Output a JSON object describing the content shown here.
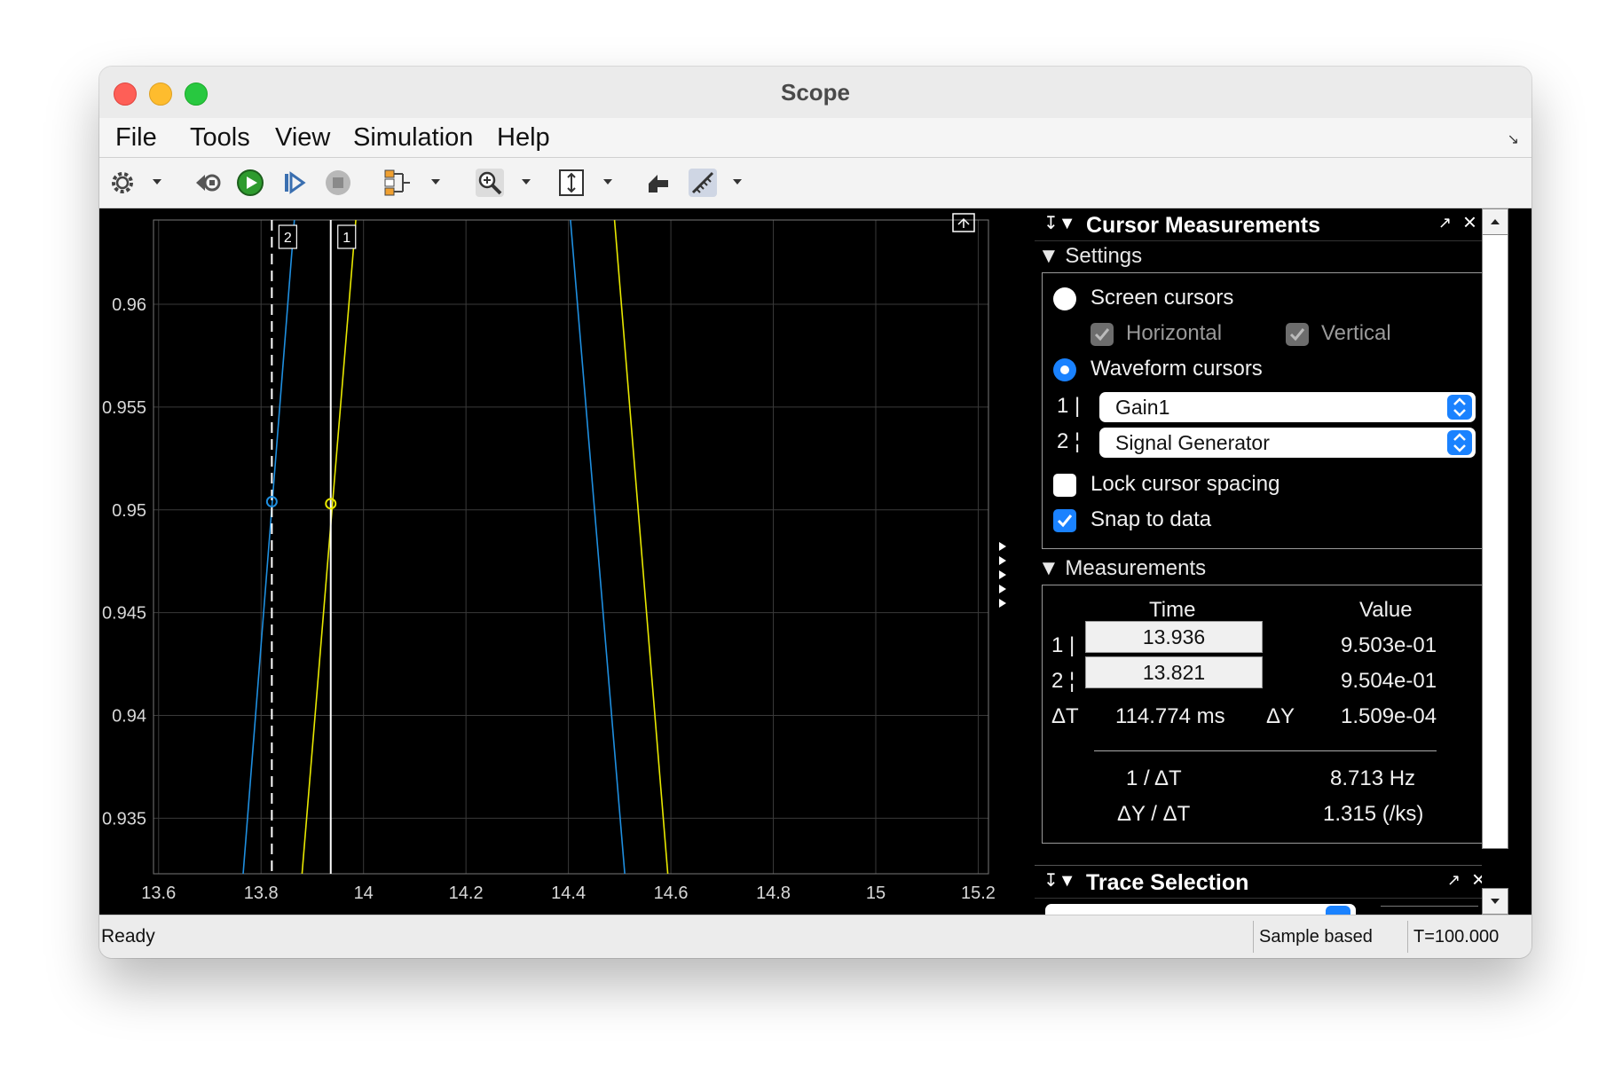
{
  "window": {
    "title": "Scope"
  },
  "menu": [
    "File",
    "Tools",
    "View",
    "Simulation",
    "Help"
  ],
  "toolbar": {
    "icons": [
      "gear-icon",
      "step-back-icon",
      "run-icon",
      "step-forward-icon",
      "stop-icon",
      "signal-routing-icon",
      "zoom-icon",
      "scale-axes-icon",
      "highlight-block-icon",
      "measurements-icon"
    ]
  },
  "chart_data": {
    "type": "line",
    "xlim": [
      13.59,
      15.22
    ],
    "ylim": [
      0.9323,
      0.9641
    ],
    "x_ticks": [
      "13.6",
      "13.8",
      "14",
      "14.2",
      "14.4",
      "14.6",
      "14.8",
      "15",
      "15.2"
    ],
    "x_tick_values": [
      13.6,
      13.8,
      14.0,
      14.2,
      14.4,
      14.6,
      14.8,
      15.0,
      15.2
    ],
    "y_ticks": [
      "0.935",
      "0.94",
      "0.945",
      "0.95",
      "0.955",
      "0.96"
    ],
    "y_tick_values": [
      0.935,
      0.94,
      0.945,
      0.95,
      0.955,
      0.96
    ],
    "grid": true,
    "series": [
      {
        "color": "#1f8fe0",
        "segments": [
          [
            [
              13.765,
              0.9323
            ],
            [
              13.865,
              0.9641
            ]
          ],
          [
            [
              14.404,
              0.9641
            ],
            [
              14.51,
              0.9323
            ]
          ]
        ]
      },
      {
        "color": "#e8e800",
        "segments": [
          [
            [
              13.88,
              0.9323
            ],
            [
              13.985,
              0.9641
            ]
          ],
          [
            [
              14.49,
              0.9641
            ],
            [
              14.594,
              0.9323
            ]
          ]
        ]
      }
    ],
    "cursors": [
      {
        "label": "1",
        "x": 13.936,
        "y": 0.9503,
        "style": "solid",
        "marker_color": "#e8e800"
      },
      {
        "label": "2",
        "x": 13.821,
        "y": 0.9504,
        "style": "dashed",
        "marker_color": "#1f8fe0"
      }
    ]
  },
  "cursor_panel": {
    "title": "Cursor Measurements",
    "settings_label": "Settings",
    "screen_cursors": "Screen cursors",
    "horizontal": "Horizontal",
    "vertical": "Vertical",
    "waveform_cursors": "Waveform cursors",
    "cursor1_tag": "1",
    "cursor2_tag": "2",
    "cursor1_signal": "Gain1",
    "cursor2_signal": "Signal Generator",
    "lock_spacing": "Lock cursor spacing",
    "snap_to_data": "Snap to data",
    "measurements_label": "Measurements",
    "time_header": "Time",
    "value_header": "Value",
    "t1": "13.936",
    "t2": "13.821",
    "v1": "9.503e-01",
    "v2": "9.504e-01",
    "dt_label": "ΔT",
    "dt_value": "114.774 ms",
    "dy_label": "ΔY",
    "dy_value": "1.509e-04",
    "inv_dt_label": "1 / ΔT",
    "inv_dt_value": "8.713 Hz",
    "slope_label": "ΔY / ΔT",
    "slope_value": "1.315 (/ks)"
  },
  "trace_panel": {
    "title": "Trace Selection"
  },
  "status": {
    "ready": "Ready",
    "mode": "Sample based",
    "time": "T=100.000"
  }
}
